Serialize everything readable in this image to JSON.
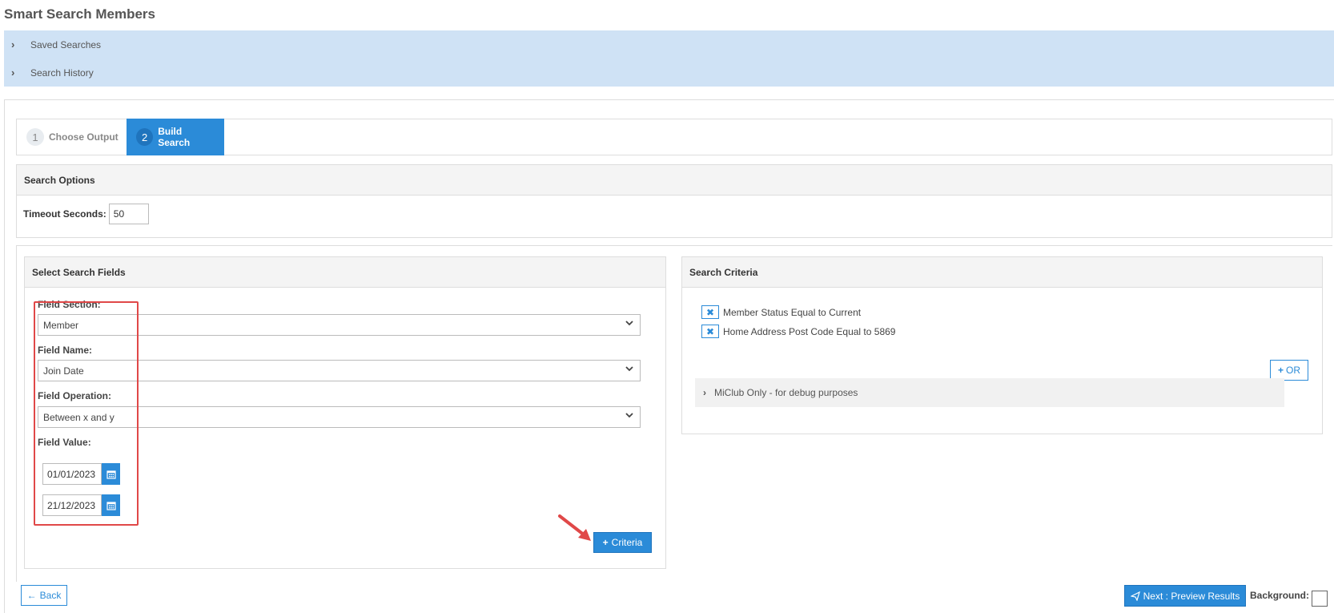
{
  "page": {
    "title": "Smart Search Members"
  },
  "accordions": [
    {
      "label": "Saved Searches"
    },
    {
      "label": "Search History"
    }
  ],
  "wizard": {
    "steps": [
      {
        "number": "1",
        "label": "Choose Output",
        "active": false
      },
      {
        "number": "2",
        "label": "Build Search",
        "active": true
      }
    ]
  },
  "search_options": {
    "heading": "Search Options",
    "timeout_label": "Timeout Seconds:",
    "timeout_value": "50"
  },
  "select_fields": {
    "heading": "Select Search Fields",
    "field_section_label": "Field Section:",
    "field_section_value": "Member",
    "field_name_label": "Field Name:",
    "field_name_value": "Join Date",
    "field_operation_label": "Field Operation:",
    "field_operation_value": "Between x and y",
    "field_value_label": "Field Value:",
    "date_from": "01/01/2023",
    "date_to": "21/12/2023",
    "add_criteria_label": "Criteria"
  },
  "search_criteria": {
    "heading": "Search Criteria",
    "items": [
      {
        "text": "Member Status Equal to Current"
      },
      {
        "text": "Home Address Post Code Equal to 5869"
      }
    ],
    "or_label": "OR",
    "debug_label": "MiClub Only - for debug purposes"
  },
  "footer": {
    "back_label": "Back",
    "next_label": "Next : Preview Results",
    "background_label": "Background:"
  },
  "colors": {
    "accent": "#2b8bd8",
    "accordion_bg": "#cfe2f5",
    "highlight": "#e04848"
  }
}
